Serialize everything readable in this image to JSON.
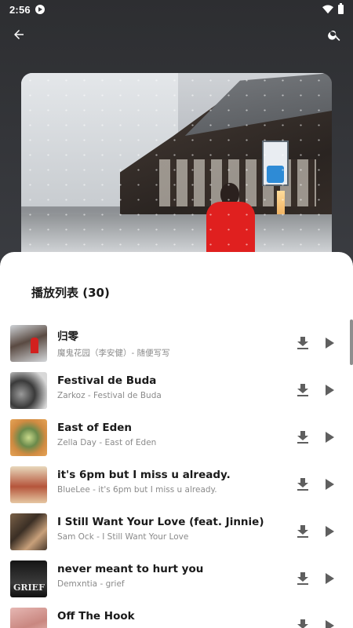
{
  "status_bar": {
    "time": "2:56"
  },
  "toolbar": {
    "back_icon": "arrow-back-icon",
    "search_icon": "search-icon"
  },
  "playlist": {
    "title": "播放列表 (30)",
    "songs": [
      {
        "title": "归零",
        "subtitle": "魔鬼花园（李安健）- 随便写写"
      },
      {
        "title": "Festival de Buda",
        "subtitle": "Zarkoz - Festival de Buda"
      },
      {
        "title": "East of Eden",
        "subtitle": "Zella Day - East of Eden"
      },
      {
        "title": "it's 6pm but I miss u already.",
        "subtitle": "BlueLee - it's 6pm but I miss u already."
      },
      {
        "title": "I Still Want Your Love (feat. Jinnie)",
        "subtitle": "Sam Ock - I Still Want Your Love"
      },
      {
        "title": "never meant to hurt you",
        "subtitle": "Demxntia - grief"
      },
      {
        "title": "Off The Hook",
        "subtitle": ""
      }
    ]
  }
}
